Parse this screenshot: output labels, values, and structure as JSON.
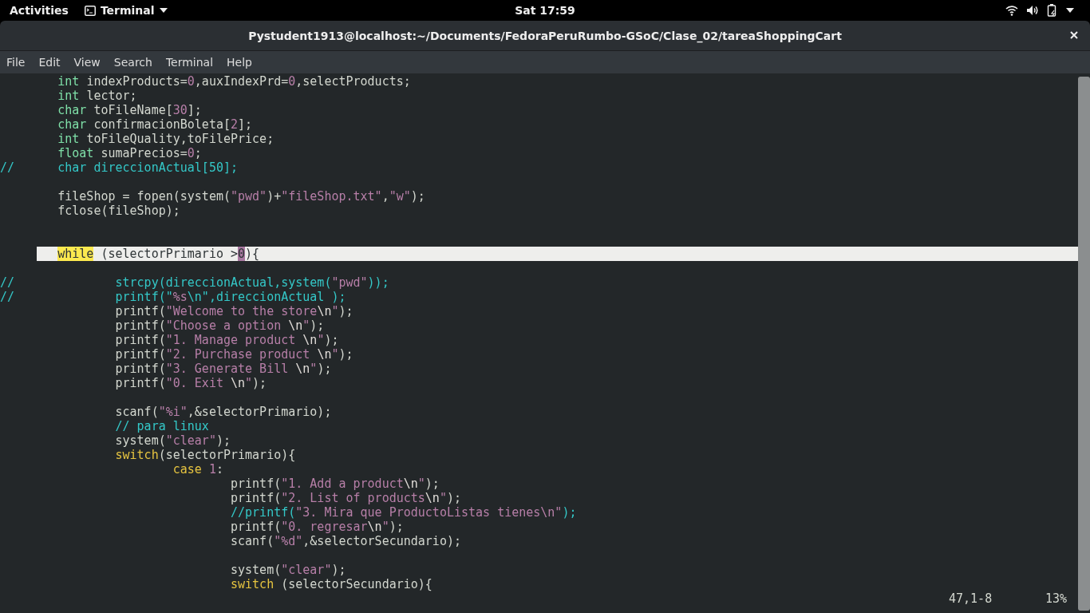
{
  "top_bar": {
    "activities": "Activities",
    "app_menu": "Terminal",
    "clock": "Sat 17:59"
  },
  "window": {
    "title": "Pystudent1913@localhost:~/Documents/FedoraPeruRumbo-GSoC/Clase_02/tareaShoppingCart"
  },
  "menu": [
    "File",
    "Edit",
    "View",
    "Search",
    "Terminal",
    "Help"
  ],
  "editor": {
    "lines": [
      {
        "current": false,
        "segs": [
          {
            "text": "        int",
            "kind": "type"
          },
          {
            "text": " indexProducts=",
            "kind": "plain"
          },
          {
            "text": "0",
            "kind": "string"
          },
          {
            "text": ",auxIndexPrd=",
            "kind": "plain"
          },
          {
            "text": "0",
            "kind": "string"
          },
          {
            "text": ",selectProducts;",
            "kind": "plain"
          }
        ]
      },
      {
        "current": false,
        "segs": [
          {
            "text": "        int",
            "kind": "type"
          },
          {
            "text": " lector;",
            "kind": "plain"
          }
        ]
      },
      {
        "current": false,
        "segs": [
          {
            "text": "        char",
            "kind": "type"
          },
          {
            "text": " toFileName[",
            "kind": "plain"
          },
          {
            "text": "30",
            "kind": "string"
          },
          {
            "text": "];",
            "kind": "plain"
          }
        ]
      },
      {
        "current": false,
        "segs": [
          {
            "text": "        char",
            "kind": "type"
          },
          {
            "text": " confirmacionBoleta[",
            "kind": "plain"
          },
          {
            "text": "2",
            "kind": "string"
          },
          {
            "text": "];",
            "kind": "plain"
          }
        ]
      },
      {
        "current": false,
        "segs": [
          {
            "text": "        int",
            "kind": "type"
          },
          {
            "text": " toFileQuality,toFilePrice;",
            "kind": "plain"
          }
        ]
      },
      {
        "current": false,
        "segs": [
          {
            "text": "        float",
            "kind": "type"
          },
          {
            "text": " sumaPrecios=",
            "kind": "plain"
          },
          {
            "text": "0",
            "kind": "string"
          },
          {
            "text": ";",
            "kind": "plain"
          }
        ]
      },
      {
        "current": false,
        "segs": [
          {
            "text": "//      char direccionActual[50];",
            "kind": "comment"
          }
        ]
      },
      {
        "current": false
      },
      {
        "current": false,
        "segs": [
          {
            "text": "        fileShop = fopen(system(",
            "kind": "plain"
          },
          {
            "text": "\"pwd\"",
            "kind": "string"
          },
          {
            "text": ")+",
            "kind": "plain"
          },
          {
            "text": "\"fileShop.txt\"",
            "kind": "string"
          },
          {
            "text": ",",
            "kind": "plain"
          },
          {
            "text": "\"w\"",
            "kind": "string"
          },
          {
            "text": ");",
            "kind": "plain"
          }
        ]
      },
      {
        "current": false,
        "segs": [
          {
            "text": "        fclose(fileShop);",
            "kind": "plain"
          }
        ]
      },
      {
        "current": false
      },
      {
        "current": false
      },
      {
        "current": true,
        "segs": [
          {
            "text": "        while",
            "kind": "search"
          },
          {
            "text": " (selectorPrimario >",
            "kind": "plain"
          },
          {
            "text": "0",
            "kind": "cursor"
          },
          {
            "text": "){",
            "kind": "plain"
          }
        ]
      },
      {
        "current": false
      },
      {
        "current": false,
        "segs": [
          {
            "text": "//              strcpy(direccionActual,system(",
            "kind": "comment"
          },
          {
            "text": "\"pwd\"",
            "kind": "string"
          },
          {
            "text": "));",
            "kind": "comment"
          }
        ]
      },
      {
        "current": false,
        "segs": [
          {
            "text": "//              printf(\"",
            "kind": "comment"
          },
          {
            "text": "%s",
            "kind": "string"
          },
          {
            "text": "\\n\",direccionActual );",
            "kind": "comment"
          }
        ]
      },
      {
        "current": false,
        "segs": [
          {
            "text": "                printf(",
            "kind": "plain"
          },
          {
            "text": "\"Welcome to the store",
            "kind": "string"
          },
          {
            "text": "\\n",
            "kind": "escape"
          },
          {
            "text": "\"",
            "kind": "string"
          },
          {
            "text": ");",
            "kind": "plain"
          }
        ]
      },
      {
        "current": false,
        "segs": [
          {
            "text": "                printf(",
            "kind": "plain"
          },
          {
            "text": "\"Choose a option ",
            "kind": "string"
          },
          {
            "text": "\\n",
            "kind": "escape"
          },
          {
            "text": "\"",
            "kind": "string"
          },
          {
            "text": ");",
            "kind": "plain"
          }
        ]
      },
      {
        "current": false,
        "segs": [
          {
            "text": "                printf(",
            "kind": "plain"
          },
          {
            "text": "\"1. Manage product ",
            "kind": "string"
          },
          {
            "text": "\\n",
            "kind": "escape"
          },
          {
            "text": "\"",
            "kind": "string"
          },
          {
            "text": ");",
            "kind": "plain"
          }
        ]
      },
      {
        "current": false,
        "segs": [
          {
            "text": "                printf(",
            "kind": "plain"
          },
          {
            "text": "\"2. Purchase product ",
            "kind": "string"
          },
          {
            "text": "\\n",
            "kind": "escape"
          },
          {
            "text": "\"",
            "kind": "string"
          },
          {
            "text": ");",
            "kind": "plain"
          }
        ]
      },
      {
        "current": false,
        "segs": [
          {
            "text": "                printf(",
            "kind": "plain"
          },
          {
            "text": "\"3. Generate Bill ",
            "kind": "string"
          },
          {
            "text": "\\n",
            "kind": "escape"
          },
          {
            "text": "\"",
            "kind": "string"
          },
          {
            "text": ");",
            "kind": "plain"
          }
        ]
      },
      {
        "current": false,
        "segs": [
          {
            "text": "                printf(",
            "kind": "plain"
          },
          {
            "text": "\"0. Exit ",
            "kind": "string"
          },
          {
            "text": "\\n",
            "kind": "escape"
          },
          {
            "text": "\"",
            "kind": "string"
          },
          {
            "text": ");",
            "kind": "plain"
          }
        ]
      },
      {
        "current": false
      },
      {
        "current": false,
        "segs": [
          {
            "text": "                scanf(",
            "kind": "plain"
          },
          {
            "text": "\"%i\"",
            "kind": "string"
          },
          {
            "text": ",&selectorPrimario);",
            "kind": "plain"
          }
        ]
      },
      {
        "current": false,
        "segs": [
          {
            "text": "                // para linux",
            "kind": "comment"
          }
        ]
      },
      {
        "current": false,
        "segs": [
          {
            "text": "                system(",
            "kind": "plain"
          },
          {
            "text": "\"clear\"",
            "kind": "string"
          },
          {
            "text": ");",
            "kind": "plain"
          }
        ]
      },
      {
        "current": false,
        "segs": [
          {
            "text": "                switch",
            "kind": "keyword"
          },
          {
            "text": "(selectorPrimario){",
            "kind": "plain"
          }
        ]
      },
      {
        "current": false,
        "segs": [
          {
            "text": "                        case",
            "kind": "keyword"
          },
          {
            "text": " 1",
            "kind": "string"
          },
          {
            "text": ":",
            "kind": "plain"
          }
        ]
      },
      {
        "current": false,
        "segs": [
          {
            "text": "                                printf(",
            "kind": "plain"
          },
          {
            "text": "\"1. Add a product",
            "kind": "string"
          },
          {
            "text": "\\n",
            "kind": "escape"
          },
          {
            "text": "\"",
            "kind": "string"
          },
          {
            "text": ");",
            "kind": "plain"
          }
        ]
      },
      {
        "current": false,
        "segs": [
          {
            "text": "                                printf(",
            "kind": "plain"
          },
          {
            "text": "\"2. List of products",
            "kind": "string"
          },
          {
            "text": "\\n",
            "kind": "escape"
          },
          {
            "text": "\"",
            "kind": "string"
          },
          {
            "text": ");",
            "kind": "plain"
          }
        ]
      },
      {
        "current": false,
        "segs": [
          {
            "text": "                                //printf(",
            "kind": "comment"
          },
          {
            "text": "\"3. Mira que ProductoListas tienes\\n\"",
            "kind": "string"
          },
          {
            "text": ");",
            "kind": "comment"
          }
        ]
      },
      {
        "current": false,
        "segs": [
          {
            "text": "                                printf(",
            "kind": "plain"
          },
          {
            "text": "\"0. regresar",
            "kind": "string"
          },
          {
            "text": "\\n",
            "kind": "escape"
          },
          {
            "text": "\"",
            "kind": "string"
          },
          {
            "text": ");",
            "kind": "plain"
          }
        ]
      },
      {
        "current": false,
        "segs": [
          {
            "text": "                                scanf(",
            "kind": "plain"
          },
          {
            "text": "\"%d\"",
            "kind": "string"
          },
          {
            "text": ",&selectorSecundario);",
            "kind": "plain"
          }
        ]
      },
      {
        "current": false
      },
      {
        "current": false,
        "segs": [
          {
            "text": "                                system(",
            "kind": "plain"
          },
          {
            "text": "\"clear\"",
            "kind": "string"
          },
          {
            "text": ");",
            "kind": "plain"
          }
        ]
      },
      {
        "current": false,
        "segs": [
          {
            "text": "                                switch",
            "kind": "keyword"
          },
          {
            "text": " (selectorSecundario){",
            "kind": "plain"
          }
        ]
      }
    ]
  },
  "status_line": {
    "position": "47,1-8",
    "percent": "13%"
  }
}
